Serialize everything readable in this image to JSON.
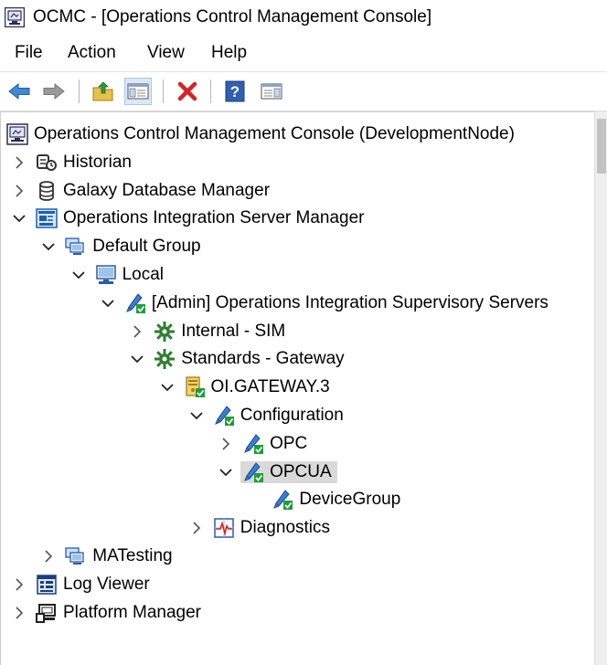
{
  "window": {
    "title": "OCMC - [Operations Control Management Console]"
  },
  "menu": [
    "File",
    "Action",
    "View",
    "Help"
  ],
  "toolbar": {
    "buttons": [
      {
        "name": "back-button",
        "icon": "back-arrow-icon"
      },
      {
        "name": "forward-button",
        "icon": "forward-arrow-icon"
      },
      {
        "name": "up-one-level-button",
        "icon": "folder-up-icon"
      },
      {
        "name": "show-hide-console-tree-button",
        "icon": "console-tree-icon",
        "active": true
      },
      {
        "name": "delete-button",
        "icon": "delete-x-icon"
      },
      {
        "name": "help-button",
        "icon": "help-icon"
      },
      {
        "name": "show-hide-action-pane-button",
        "icon": "action-pane-icon"
      }
    ]
  },
  "tree": [
    {
      "id": "root",
      "label": "Operations Control Management Console (DevelopmentNode)",
      "icon": "console-icon",
      "level": 0,
      "expander": "none"
    },
    {
      "id": "historian",
      "label": "Historian",
      "icon": "historian-icon",
      "level": 1,
      "expander": "collapsed"
    },
    {
      "id": "galaxy-db",
      "label": "Galaxy Database Manager",
      "icon": "database-icon",
      "level": 1,
      "expander": "collapsed"
    },
    {
      "id": "ois-manager",
      "label": "Operations Integration Server Manager",
      "icon": "server-manager-icon",
      "level": 1,
      "expander": "expanded"
    },
    {
      "id": "default-group",
      "label": "Default Group",
      "icon": "group-icon",
      "level": 2,
      "expander": "expanded"
    },
    {
      "id": "local",
      "label": "Local",
      "icon": "computer-icon",
      "level": 3,
      "expander": "expanded"
    },
    {
      "id": "admin-servers",
      "label": "[Admin] Operations Integration Supervisory Servers",
      "icon": "pen-check-icon",
      "level": 4,
      "expander": "expanded"
    },
    {
      "id": "internal-sim",
      "label": "Internal - SIM",
      "icon": "gear-icon",
      "level": 5,
      "expander": "collapsed"
    },
    {
      "id": "standards-gateway",
      "label": "Standards - Gateway",
      "icon": "gear-icon",
      "level": 5,
      "expander": "expanded"
    },
    {
      "id": "oi-gateway",
      "label": "OI.GATEWAY.3",
      "icon": "server-check-icon",
      "level": 6,
      "expander": "expanded"
    },
    {
      "id": "configuration",
      "label": "Configuration",
      "icon": "pen-check-icon",
      "level": 7,
      "expander": "expanded"
    },
    {
      "id": "opc",
      "label": "OPC",
      "icon": "pen-check-icon",
      "level": 8,
      "expander": "collapsed"
    },
    {
      "id": "opcua",
      "label": "OPCUA",
      "icon": "pen-check-icon",
      "level": 8,
      "expander": "expanded",
      "selected": true
    },
    {
      "id": "device-group",
      "label": "DeviceGroup",
      "icon": "pen-check-icon",
      "level": 9,
      "expander": "none"
    },
    {
      "id": "diagnostics",
      "label": "Diagnostics",
      "icon": "diagnostics-icon",
      "level": 7,
      "expander": "collapsed"
    },
    {
      "id": "matesting",
      "label": "MATesting",
      "icon": "group-icon",
      "level": 2,
      "expander": "collapsed"
    },
    {
      "id": "log-viewer",
      "label": "Log Viewer",
      "icon": "log-viewer-icon",
      "level": 1,
      "expander": "collapsed"
    },
    {
      "id": "platform-manager",
      "label": "Platform Manager",
      "icon": "platform-icon",
      "level": 1,
      "expander": "collapsed"
    }
  ],
  "colors": {
    "selection": "#d9d9d9",
    "accent": "#1a5fb4",
    "check": "#1e9e3a"
  }
}
